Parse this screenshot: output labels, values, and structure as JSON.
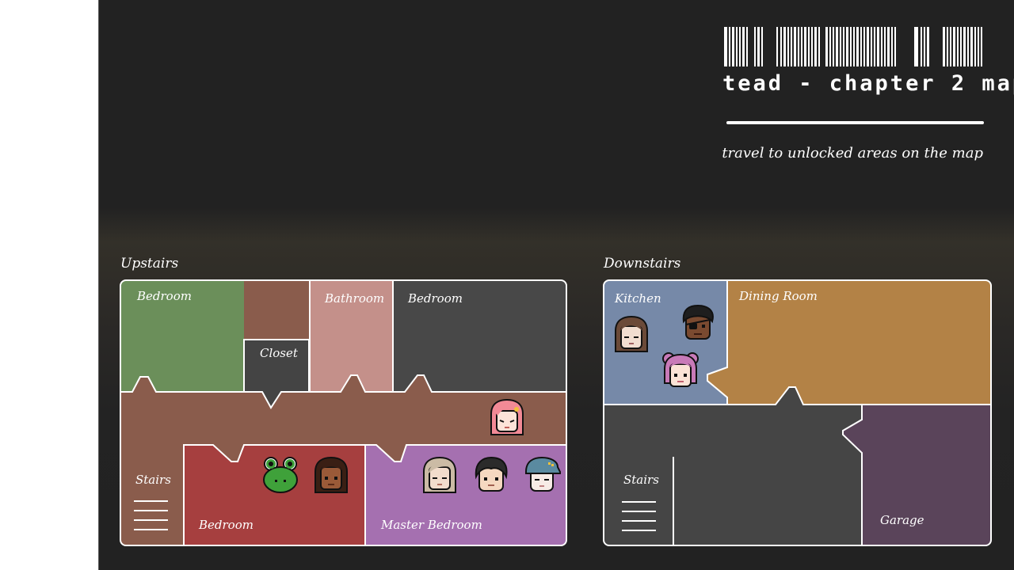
{
  "game": {
    "title": "tead - chapter 2 map",
    "subtitle": "travel to unlocked areas on the map"
  },
  "colors": {
    "background": "#222222",
    "bedroom_green": "#6b8f5a",
    "bathroom": "#c4908a",
    "bedroom_gray": "#484848",
    "hallway": "#8a5c4c",
    "closet": "#444444",
    "bedroom_red": "#a63f3f",
    "master_bedroom": "#a570b0",
    "kitchen": "#7689a8",
    "dining_room": "#b38246",
    "living_area": "#454545",
    "garage": "#5a445a",
    "outline": "#ffffff"
  },
  "upstairs": {
    "label": "Upstairs",
    "rooms": {
      "bedroom_tl": "Bedroom",
      "bathroom": "Bathroom",
      "bedroom_tr": "Bedroom",
      "closet": "Closet",
      "stairs": "Stairs",
      "bedroom_bottom": "Bedroom",
      "master_bedroom": "Master Bedroom"
    }
  },
  "downstairs": {
    "label": "Downstairs",
    "rooms": {
      "kitchen": "Kitchen",
      "dining_room": "Dining Room",
      "stairs": "Stairs",
      "garage": "Garage"
    }
  },
  "characters": [
    {
      "id": "pink-haired-girl",
      "room": "hallway"
    },
    {
      "id": "frog",
      "room": "bedroom_bottom"
    },
    {
      "id": "curly-haired-girl",
      "room": "bedroom_bottom"
    },
    {
      "id": "blonde-woman",
      "room": "master_bedroom"
    },
    {
      "id": "dark-haired-boy",
      "room": "master_bedroom"
    },
    {
      "id": "capped-kid",
      "room": "master_bedroom"
    },
    {
      "id": "brown-haired-girl",
      "room": "kitchen"
    },
    {
      "id": "eyepatch-man",
      "room": "kitchen"
    },
    {
      "id": "pink-bun-girl",
      "room": "kitchen"
    }
  ]
}
